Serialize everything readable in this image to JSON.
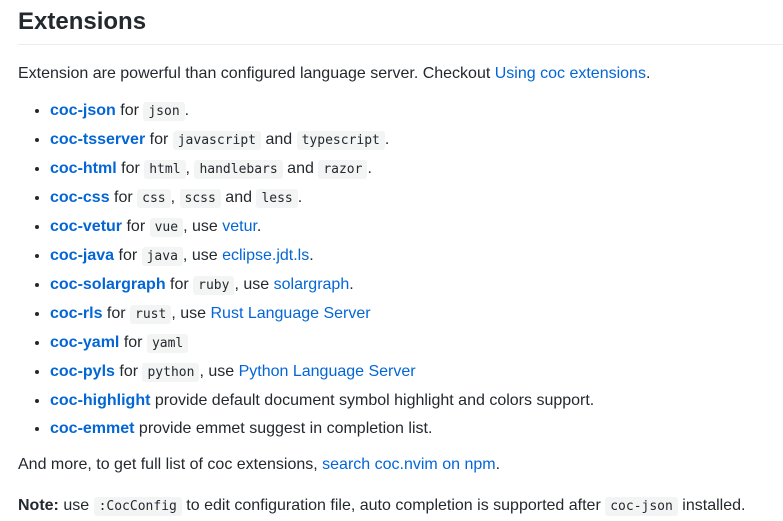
{
  "heading": "Extensions",
  "intro": {
    "text": "Extension are powerful than configured language server. Checkout ",
    "link": "Using coc extensions",
    "end": "."
  },
  "extensions": [
    {
      "name": "coc-json",
      "parts": [
        {
          "t": "text",
          "v": " for "
        },
        {
          "t": "code",
          "v": "json"
        },
        {
          "t": "text",
          "v": "."
        }
      ]
    },
    {
      "name": "coc-tsserver",
      "parts": [
        {
          "t": "text",
          "v": " for "
        },
        {
          "t": "code",
          "v": "javascript"
        },
        {
          "t": "text",
          "v": " and "
        },
        {
          "t": "code",
          "v": "typescript"
        },
        {
          "t": "text",
          "v": "."
        }
      ]
    },
    {
      "name": "coc-html",
      "parts": [
        {
          "t": "text",
          "v": " for "
        },
        {
          "t": "code",
          "v": "html"
        },
        {
          "t": "text",
          "v": ", "
        },
        {
          "t": "code",
          "v": "handlebars"
        },
        {
          "t": "text",
          "v": " and "
        },
        {
          "t": "code",
          "v": "razor"
        },
        {
          "t": "text",
          "v": "."
        }
      ]
    },
    {
      "name": "coc-css",
      "parts": [
        {
          "t": "text",
          "v": " for "
        },
        {
          "t": "code",
          "v": "css"
        },
        {
          "t": "text",
          "v": ", "
        },
        {
          "t": "code",
          "v": "scss"
        },
        {
          "t": "text",
          "v": " and "
        },
        {
          "t": "code",
          "v": "less"
        },
        {
          "t": "text",
          "v": "."
        }
      ]
    },
    {
      "name": "coc-vetur",
      "parts": [
        {
          "t": "text",
          "v": " for "
        },
        {
          "t": "code",
          "v": "vue"
        },
        {
          "t": "text",
          "v": ", use "
        },
        {
          "t": "link",
          "v": "vetur"
        },
        {
          "t": "text",
          "v": "."
        }
      ]
    },
    {
      "name": "coc-java",
      "parts": [
        {
          "t": "text",
          "v": " for "
        },
        {
          "t": "code",
          "v": "java"
        },
        {
          "t": "text",
          "v": ", use "
        },
        {
          "t": "link",
          "v": "eclipse.jdt.ls"
        },
        {
          "t": "text",
          "v": "."
        }
      ]
    },
    {
      "name": "coc-solargraph",
      "parts": [
        {
          "t": "text",
          "v": " for "
        },
        {
          "t": "code",
          "v": "ruby"
        },
        {
          "t": "text",
          "v": ", use "
        },
        {
          "t": "link",
          "v": "solargraph"
        },
        {
          "t": "text",
          "v": "."
        }
      ]
    },
    {
      "name": "coc-rls",
      "parts": [
        {
          "t": "text",
          "v": " for "
        },
        {
          "t": "code",
          "v": "rust"
        },
        {
          "t": "text",
          "v": ", use "
        },
        {
          "t": "link",
          "v": "Rust Language Server"
        }
      ]
    },
    {
      "name": "coc-yaml",
      "parts": [
        {
          "t": "text",
          "v": " for "
        },
        {
          "t": "code",
          "v": "yaml"
        }
      ]
    },
    {
      "name": "coc-pyls",
      "parts": [
        {
          "t": "text",
          "v": " for "
        },
        {
          "t": "code",
          "v": "python"
        },
        {
          "t": "text",
          "v": ", use "
        },
        {
          "t": "link",
          "v": "Python Language Server"
        }
      ]
    },
    {
      "name": "coc-highlight",
      "parts": [
        {
          "t": "text",
          "v": " provide default document symbol highlight and colors support."
        }
      ]
    },
    {
      "name": "coc-emmet",
      "parts": [
        {
          "t": "text",
          "v": " provide emmet suggest in completion list."
        }
      ]
    }
  ],
  "more": {
    "text": "And more, to get full list of coc extensions, ",
    "link": "search coc.nvim on npm",
    "end": "."
  },
  "note": {
    "label": "Note:",
    "text1": " use ",
    "code1": ":CocConfig",
    "text2": " to edit configuration file, auto completion is supported after ",
    "code2": "coc-json",
    "text3": " installed."
  }
}
